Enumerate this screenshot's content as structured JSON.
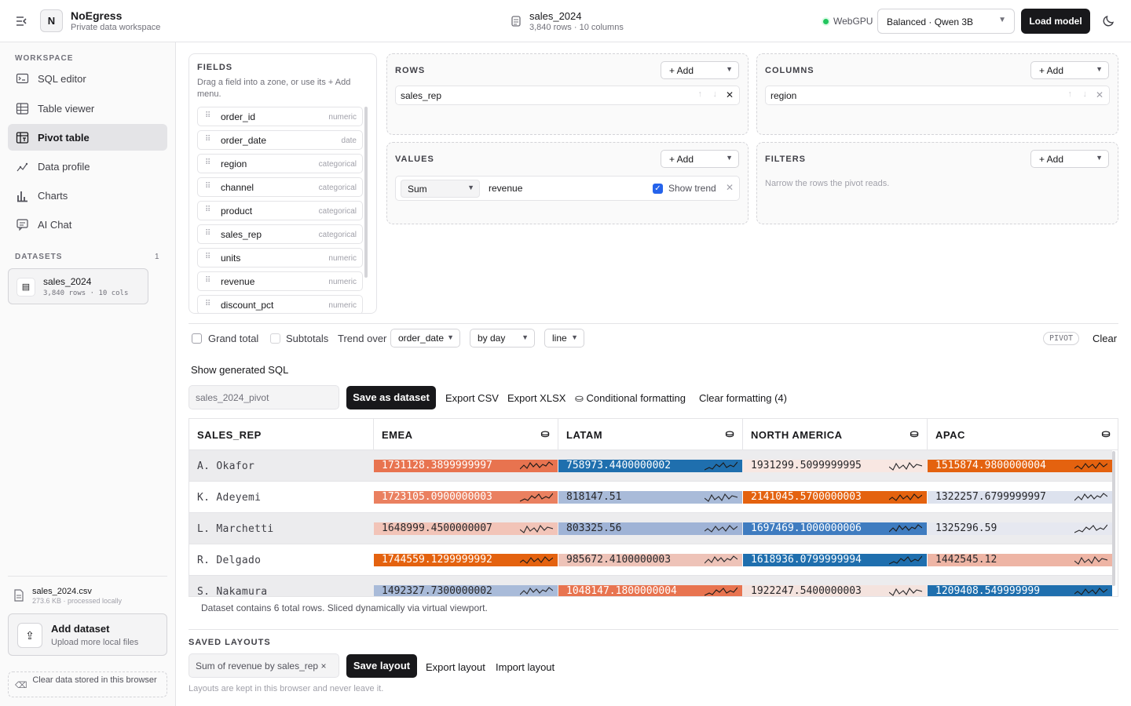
{
  "header": {
    "app_name": "NoEgress",
    "app_subtitle": "Private data workspace",
    "dataset_name": "sales_2024",
    "dataset_meta": "3,840 rows · 10 columns",
    "webgpu_label": "WebGPU",
    "model_select": "Balanced · Qwen 3B",
    "load_model": "Load model",
    "logo_letter": "N"
  },
  "sidebar": {
    "workspace_label": "WORKSPACE",
    "nav": [
      {
        "label": "SQL editor",
        "icon": "terminal-icon"
      },
      {
        "label": "Table viewer",
        "icon": "table-icon"
      },
      {
        "label": "Pivot table",
        "icon": "pivot-icon",
        "active": true
      },
      {
        "label": "Data profile",
        "icon": "profile-icon"
      },
      {
        "label": "Charts",
        "icon": "bar-chart-icon"
      },
      {
        "label": "AI Chat",
        "icon": "chat-icon"
      }
    ],
    "datasets_label": "DATASETS",
    "datasets_count": "1",
    "dataset_card": {
      "name": "sales_2024",
      "meta": "3,840 rows · 10 cols"
    },
    "file": {
      "name": "sales_2024.csv",
      "meta": "273.6 KB · processed locally"
    },
    "add_dataset": {
      "title": "Add dataset",
      "subtitle": "Upload more local files"
    },
    "clear_storage": "Clear data stored in this browser"
  },
  "fields": {
    "title": "FIELDS",
    "help": "Drag a field into a zone, or use its + Add menu.",
    "items": [
      {
        "name": "order_id",
        "type": "numeric"
      },
      {
        "name": "order_date",
        "type": "date"
      },
      {
        "name": "region",
        "type": "categorical"
      },
      {
        "name": "channel",
        "type": "categorical"
      },
      {
        "name": "product",
        "type": "categorical"
      },
      {
        "name": "sales_rep",
        "type": "categorical"
      },
      {
        "name": "units",
        "type": "numeric"
      },
      {
        "name": "revenue",
        "type": "numeric"
      },
      {
        "name": "discount_pct",
        "type": "numeric"
      }
    ]
  },
  "zones": {
    "add_label": "+ Add",
    "rows": {
      "title": "ROWS",
      "chip": "sales_rep"
    },
    "columns": {
      "title": "COLUMNS",
      "chip": "region"
    },
    "values": {
      "title": "VALUES",
      "agg": "Sum",
      "field": "revenue",
      "trend_label": "Show trend"
    },
    "filters": {
      "title": "FILTERS",
      "help": "Narrow the rows the pivot reads."
    }
  },
  "options": {
    "grand_total": "Grand total",
    "subtotals": "Subtotals",
    "trend_over": "Trend over",
    "trend_field": "order_date",
    "trend_period": "by day",
    "trend_style": "line",
    "badge": "PIVOT",
    "clear": "Clear",
    "show_sql": "Show generated SQL"
  },
  "actions": {
    "dataset_name_value": "sales_2024_pivot",
    "save_dataset": "Save as dataset",
    "export_csv": "Export CSV",
    "export_xlsx": "Export XLSX",
    "conditional": "Conditional formatting",
    "clear_formatting": "Clear formatting (4)"
  },
  "table": {
    "headers": [
      "SALES_REP",
      "EMEA",
      "LATAM",
      "NORTH AMERICA",
      "APAC"
    ],
    "rows": [
      {
        "rep": "A. Okafor",
        "values": [
          "1731128.3899999997",
          "758973.4400000002",
          "1931299.5099999995",
          "1515874.9800000004"
        ],
        "colors": [
          "#e8734f",
          "#1f6fae",
          "#f8e7e2",
          "#e4620f"
        ]
      },
      {
        "rep": "K. Adeyemi",
        "values": [
          "1723105.0900000003",
          "818147.51",
          "2141045.5700000003",
          "1322257.6799999997"
        ],
        "colors": [
          "#ea8060",
          "#a9bbd9",
          "#e4620f",
          "#dde2ee"
        ]
      },
      {
        "rep": "L. Marchetti",
        "values": [
          "1648999.4500000007",
          "803325.56",
          "1697469.1000000006",
          "1325296.59"
        ],
        "colors": [
          "#f2c4b8",
          "#9fb3d6",
          "#3f7cc0",
          "#e6e8f0"
        ]
      },
      {
        "rep": "R. Delgado",
        "values": [
          "1744559.1299999992",
          "985672.4100000003",
          "1618936.0799999994",
          "1442545.12"
        ],
        "colors": [
          "#e4620f",
          "#eec3b8",
          "#1f6fae",
          "#eeb5a5"
        ]
      },
      {
        "rep": "S. Nakamura",
        "values": [
          "1492327.7300000002",
          "1048147.1800000004",
          "1922247.5400000003",
          "1209408.549999999"
        ],
        "colors": [
          "#a9bbd9",
          "#e87450",
          "#f4e3de",
          "#1f6fae"
        ]
      }
    ],
    "footer": "Dataset contains 6 total rows. Sliced dynamically via virtual viewport."
  },
  "layouts": {
    "title": "SAVED LAYOUTS",
    "current": "Sum of revenue by sales_rep",
    "save": "Save layout",
    "export": "Export layout",
    "import": "Import layout",
    "note": "Layouts are kept in this browser and never leave it."
  }
}
